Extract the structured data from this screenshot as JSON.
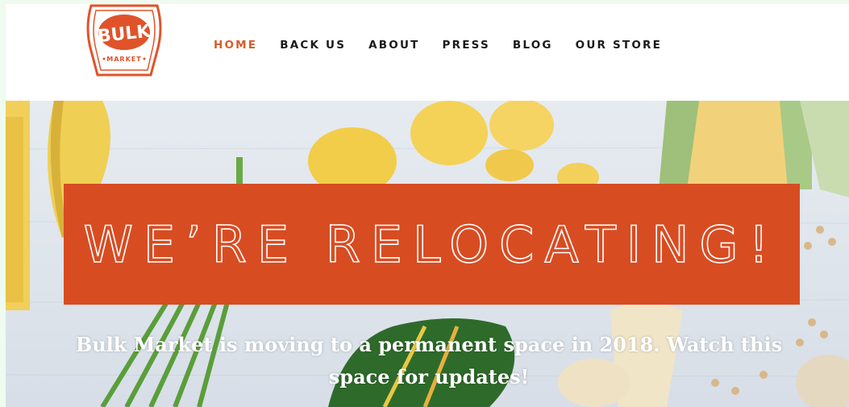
{
  "brand": {
    "logo_top": "BULK",
    "logo_bottom": "MARKET",
    "color": "#e0532a"
  },
  "nav": {
    "items": [
      {
        "label": "HOME",
        "active": true
      },
      {
        "label": "BACK US",
        "active": false
      },
      {
        "label": "ABOUT",
        "active": false
      },
      {
        "label": "PRESS",
        "active": false
      },
      {
        "label": "BLOG",
        "active": false
      },
      {
        "label": "OUR STORE",
        "active": false
      }
    ],
    "active_color": "#d95a2b"
  },
  "hero": {
    "headline": "WE’RE RELOCATING!",
    "subtext": "Bulk Market is moving to a permanent space in 2018. Watch this space for updates!",
    "banner_color": "#d84c22"
  }
}
